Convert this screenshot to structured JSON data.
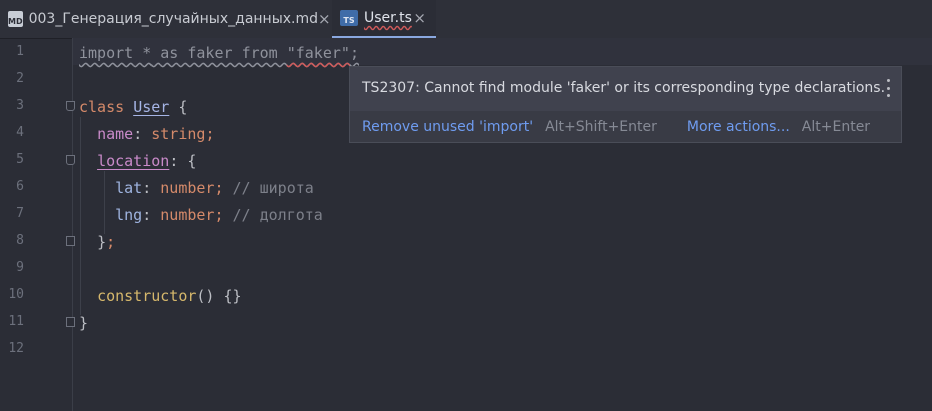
{
  "tabs": [
    {
      "icon": "MD",
      "label": "003_Генерация_случайных_данных.md",
      "close": "×"
    },
    {
      "icon": "TS",
      "label": "User.ts",
      "close": "×"
    }
  ],
  "gutter": {
    "line_numbers": [
      "1",
      "2",
      "3",
      "4",
      "5",
      "6",
      "7",
      "8",
      "9",
      "10",
      "11",
      "12"
    ]
  },
  "code": {
    "l1": {
      "import": "import",
      "star": "*",
      "as": "as",
      "faker": "faker",
      "from": "from",
      "module": "\"faker\"",
      "semi": ";"
    },
    "l3": {
      "kw": "class",
      "name": "User",
      "brace": "{"
    },
    "l4": {
      "prop": "name",
      "colon": ":",
      "type": "string",
      "semi": ";"
    },
    "l5": {
      "prop": "location",
      "colon": ":",
      "brace": "{"
    },
    "l6": {
      "prop": "lat",
      "colon": ":",
      "type": "number",
      "semi": ";",
      "comment": "// широта"
    },
    "l7": {
      "prop": "lng",
      "colon": ":",
      "type": "number",
      "semi": ";",
      "comment": "// долгота"
    },
    "l8": {
      "close": "}",
      "semi": ";"
    },
    "l10": {
      "fn": "constructor",
      "parens": "()",
      "body": "{}"
    },
    "l11": {
      "close": "}"
    }
  },
  "popup": {
    "message": "TS2307: Cannot find module 'faker' or its corresponding type declarations.",
    "action1": "Remove unused 'import'",
    "shortcut1": "Alt+Shift+Enter",
    "action2": "More actions...",
    "shortcut2": "Alt+Enter"
  }
}
